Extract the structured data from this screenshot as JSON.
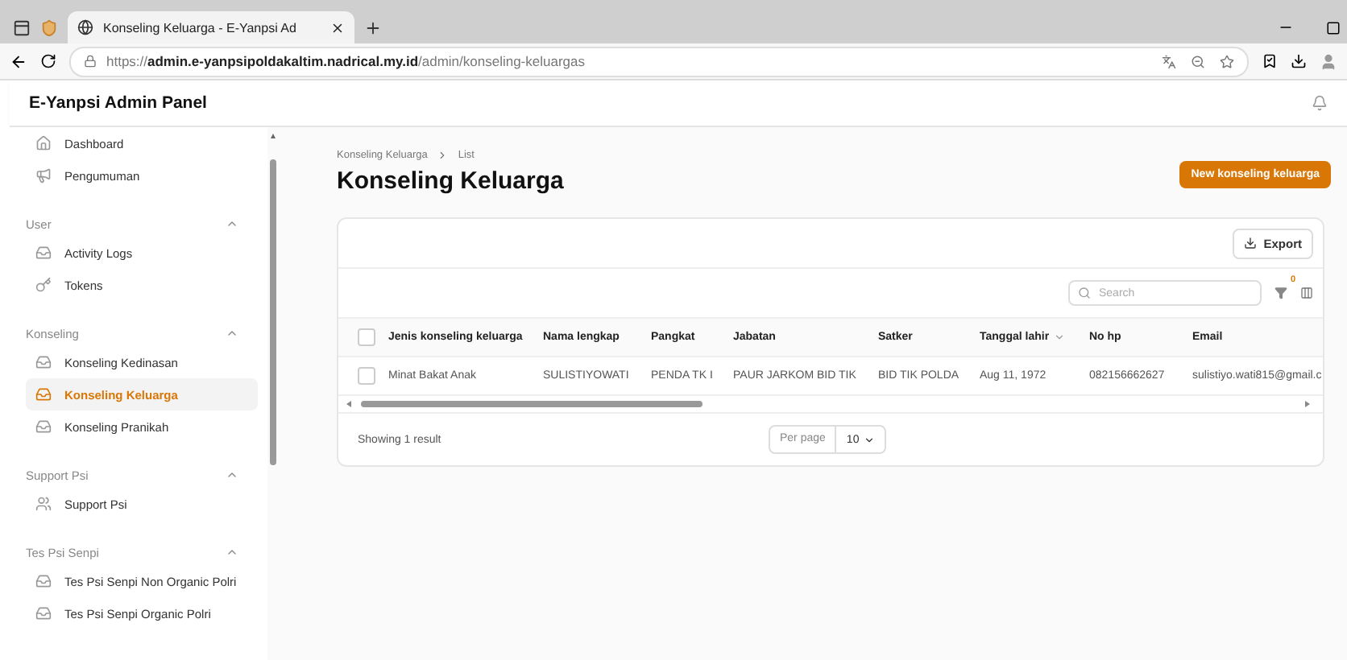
{
  "browser": {
    "tab_title": "Konseling Keluarga - E-Yanpsi Ad",
    "url_scheme": "https://",
    "url_host": "admin.e-yanpsipoldakaltim.nadrical.my.id",
    "url_path": "/admin/konseling-keluargas"
  },
  "app": {
    "title": "E-Yanpsi Admin Panel"
  },
  "sidebar": {
    "groups": [
      {
        "items": [
          {
            "label": "Dashboard",
            "selected": false
          },
          {
            "label": "Pengumuman",
            "selected": false
          }
        ]
      },
      {
        "label": "User",
        "expanded": true,
        "items": [
          {
            "label": "Activity Logs",
            "selected": false
          },
          {
            "label": "Tokens",
            "selected": false
          }
        ]
      },
      {
        "label": "Konseling",
        "expanded": true,
        "items": [
          {
            "label": "Konseling Kedinasan",
            "selected": false
          },
          {
            "label": "Konseling Keluarga",
            "selected": true
          },
          {
            "label": "Konseling Pranikah",
            "selected": false
          }
        ]
      },
      {
        "label": "Support Psi",
        "expanded": true,
        "items": [
          {
            "label": "Support Psi",
            "selected": false
          }
        ]
      },
      {
        "label": "Tes Psi Senpi",
        "expanded": true,
        "items": [
          {
            "label": "Tes Psi Senpi Non Organic Polri",
            "selected": false
          },
          {
            "label": "Tes Psi Senpi Organic Polri",
            "selected": false
          }
        ]
      }
    ]
  },
  "breadcrumbs": [
    "Konseling Keluarga",
    "List"
  ],
  "heading": "Konseling Keluarga",
  "new_button": "New konseling keluarga",
  "export_button": "Export",
  "search": {
    "placeholder": "Search"
  },
  "filter_count": "0",
  "table": {
    "all_checked": false,
    "columns": [
      {
        "label": "Jenis konseling keluarga",
        "sortable": false
      },
      {
        "label": "Nama lengkap",
        "sortable": false
      },
      {
        "label": "Pangkat",
        "sortable": false
      },
      {
        "label": "Jabatan",
        "sortable": false
      },
      {
        "label": "Satker",
        "sortable": false
      },
      {
        "label": "Tanggal lahir",
        "sortable": true
      },
      {
        "label": "No hp",
        "sortable": false
      },
      {
        "label": "Email",
        "sortable": false
      }
    ],
    "rows": [
      {
        "checked": false,
        "cells": [
          "Minat Bakat Anak",
          "SULISTIYOWATI",
          "PENDA TK I",
          "PAUR JARKOM BID TIK",
          "BID TIK POLDA",
          "Aug 11, 1972",
          "082156662627",
          "sulistiyo.wati815@gmail.c"
        ]
      }
    ]
  },
  "footer": {
    "summary": "Showing 1 result",
    "per_page_label": "Per page",
    "per_page": "10"
  }
}
